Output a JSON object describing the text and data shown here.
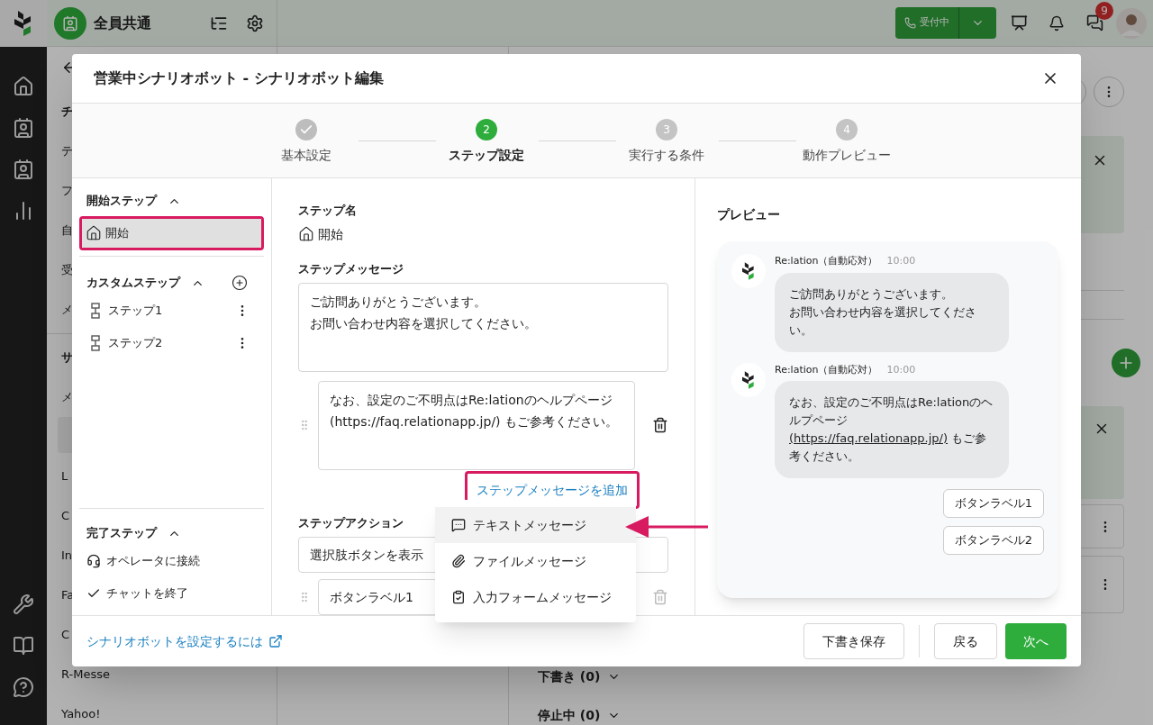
{
  "app": {
    "workspace": "全員共通",
    "status_button": "受付中",
    "notification_count": "9"
  },
  "background": {
    "sidebar_items": [
      {
        "text": "チ",
        "kind": "heading"
      },
      {
        "text": "テ",
        "kind": "item"
      },
      {
        "text": "フ",
        "kind": "item"
      },
      {
        "text": "自",
        "kind": "item"
      },
      {
        "text": "受",
        "kind": "item"
      },
      {
        "text": "メ",
        "kind": "item"
      },
      {
        "text": "サ",
        "kind": "heading"
      },
      {
        "text": "メ",
        "kind": "item"
      },
      {
        "text": "L",
        "kind": "item"
      },
      {
        "text": "C",
        "kind": "item"
      },
      {
        "text": "In",
        "kind": "item"
      },
      {
        "text": "Fa",
        "kind": "item"
      },
      {
        "text": "C",
        "kind": "item"
      },
      {
        "text": "R-Messe",
        "kind": "item"
      },
      {
        "text": "Yahoo!",
        "kind": "item"
      }
    ],
    "sections": [
      "下書き (0)",
      "停止中 (0)"
    ]
  },
  "modal": {
    "title": "営業中シナリオボット - シナリオボット編集",
    "steps": [
      {
        "label": "基本設定",
        "completed": true,
        "selected": false
      },
      {
        "number": "2",
        "label": "ステップ設定",
        "completed": false,
        "selected": true
      },
      {
        "number": "3",
        "label": "実行する条件",
        "completed": false,
        "selected": false
      },
      {
        "number": "4",
        "label": "動作プレビュー",
        "completed": false,
        "selected": false
      }
    ],
    "step_tree": {
      "start": {
        "title": "開始ステップ",
        "expanded": true,
        "items": [
          {
            "label": "開始",
            "selected": true
          }
        ]
      },
      "custom": {
        "title": "カスタムステップ",
        "expanded": true,
        "items": [
          {
            "label": "ステップ1",
            "selected": false
          },
          {
            "label": "ステップ2",
            "selected": false
          }
        ]
      },
      "end": {
        "title": "完了ステップ",
        "expanded": true,
        "items": [
          {
            "label": "オペレータに接続",
            "kind": "operator"
          },
          {
            "label": "チャットを終了",
            "kind": "finish"
          }
        ]
      }
    },
    "editor": {
      "step_name_label": "ステップ名",
      "step_name": "開始",
      "message_label": "ステップメッセージ",
      "messages": [
        [
          "ご訪問ありがとうございます。",
          "お問い合わせ内容を選択してください。"
        ],
        [
          "なお、設定のご不明点はRe:lationのヘルプページ (https://faq.relationapp.jp/) もご参考ください。"
        ]
      ],
      "add_message_link": "ステップメッセージを追加",
      "action_label": "ステップアクション",
      "action_value": "選択肢ボタンを表示",
      "button_labels": [
        "ボタンラベル1"
      ],
      "menu": [
        {
          "label": "テキストメッセージ",
          "kind": "text",
          "selected": true
        },
        {
          "label": "ファイルメッセージ",
          "kind": "file",
          "selected": false
        },
        {
          "label": "入力フォームメッセージ",
          "kind": "form",
          "selected": false
        }
      ]
    },
    "preview": {
      "title": "プレビュー",
      "messages": [
        {
          "sender": "Re:lation（自動応対）",
          "time": "10:00",
          "lines": [
            "ご訪問ありがとうございます。",
            "お問い合わせ内容を選択してください。"
          ]
        },
        {
          "sender": "Re:lation（自動応対）",
          "time": "10:00",
          "text": "なお、設定のご不明点はRe:lationのヘルプページ ",
          "link": "(https://faq.relationapp.jp/)",
          "text_after": " もご参考ください。"
        }
      ],
      "buttons": [
        "ボタンラベル1",
        "ボタンラベル2"
      ]
    },
    "footer": {
      "help_link": "シナリオボットを設定するには",
      "buttons": [
        {
          "label": "下書き保存",
          "kind": "secondary"
        },
        {
          "label": "戻る",
          "kind": "secondary"
        },
        {
          "label": "次へ",
          "kind": "primary"
        }
      ]
    }
  }
}
